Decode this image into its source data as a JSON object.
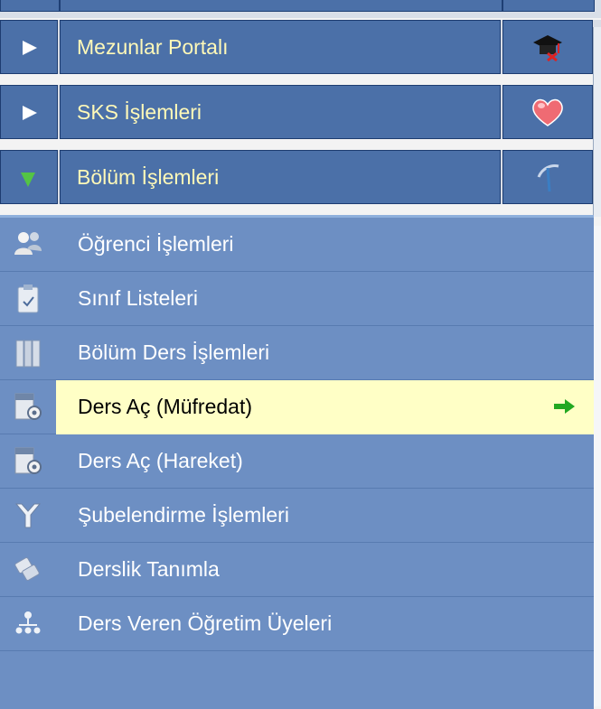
{
  "menu": {
    "items": [
      {
        "label": "Mezunlar Portalı",
        "state": "collapsed",
        "icon": "graduation-cap-icon"
      },
      {
        "label": "SKS İşlemleri",
        "state": "collapsed",
        "icon": "heart-icon"
      },
      {
        "label": "Bölüm İşlemleri",
        "state": "expanded",
        "icon": "pickaxe-icon"
      }
    ],
    "submenu": [
      {
        "label": "Öğrenci İşlemleri",
        "icon": "students-icon"
      },
      {
        "label": "Sınıf Listeleri",
        "icon": "clipboard-icon"
      },
      {
        "label": "Bölüm Ders İşlemleri",
        "icon": "binders-icon"
      },
      {
        "label": "Ders Aç (Müfredat)",
        "icon": "document-gear-icon",
        "selected": true
      },
      {
        "label": "Ders Aç (Hareket)",
        "icon": "document-gear-icon"
      },
      {
        "label": "Şubelendirme İşlemleri",
        "icon": "split-arrows-icon"
      },
      {
        "label": "Derslik Tanımla",
        "icon": "papers-icon"
      },
      {
        "label": "Ders Veren Öğretim Üyeleri",
        "icon": "org-chart-icon"
      }
    ]
  },
  "colors": {
    "header_bg": "#4b70a8",
    "header_text": "#fff9b8",
    "submenu_bg": "#6d8fc3",
    "highlight": "#ffffc6"
  }
}
